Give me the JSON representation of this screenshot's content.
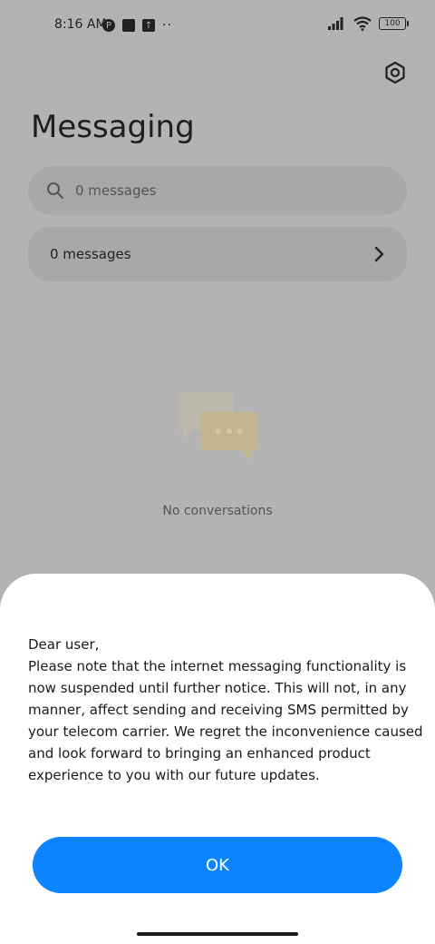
{
  "status_bar": {
    "time": "8:16 AM",
    "battery": "100",
    "left_icons": [
      "p-circle-icon",
      "square-icon",
      "upload-icon",
      "more-dots-icon"
    ],
    "right_icons": [
      "signal-icon",
      "wifi-icon",
      "battery-icon"
    ],
    "dots": "··"
  },
  "header": {
    "title": "Messaging",
    "settings_icon": "gear-icon"
  },
  "search": {
    "placeholder": "0 messages",
    "icon": "search-icon"
  },
  "messages_row": {
    "label": "0 messages",
    "icon": "chevron-right-icon"
  },
  "empty_state": {
    "icon": "chat-bubbles-icon",
    "text": "No conversations"
  },
  "dialog": {
    "greeting": "Dear user,",
    "body": "Please note that the internet messaging functionality is now suspended until further notice. This will not, in any manner, affect sending and receiving SMS permitted by your telecom carrier. We regret the inconvenience caused and look forward to bringing an enhanced product experience to you with our future updates.",
    "ok_label": "OK"
  },
  "colors": {
    "overlay_bg": "#b3b3b3",
    "accent": "#0d84ff",
    "sheet_bg": "#ffffff"
  }
}
